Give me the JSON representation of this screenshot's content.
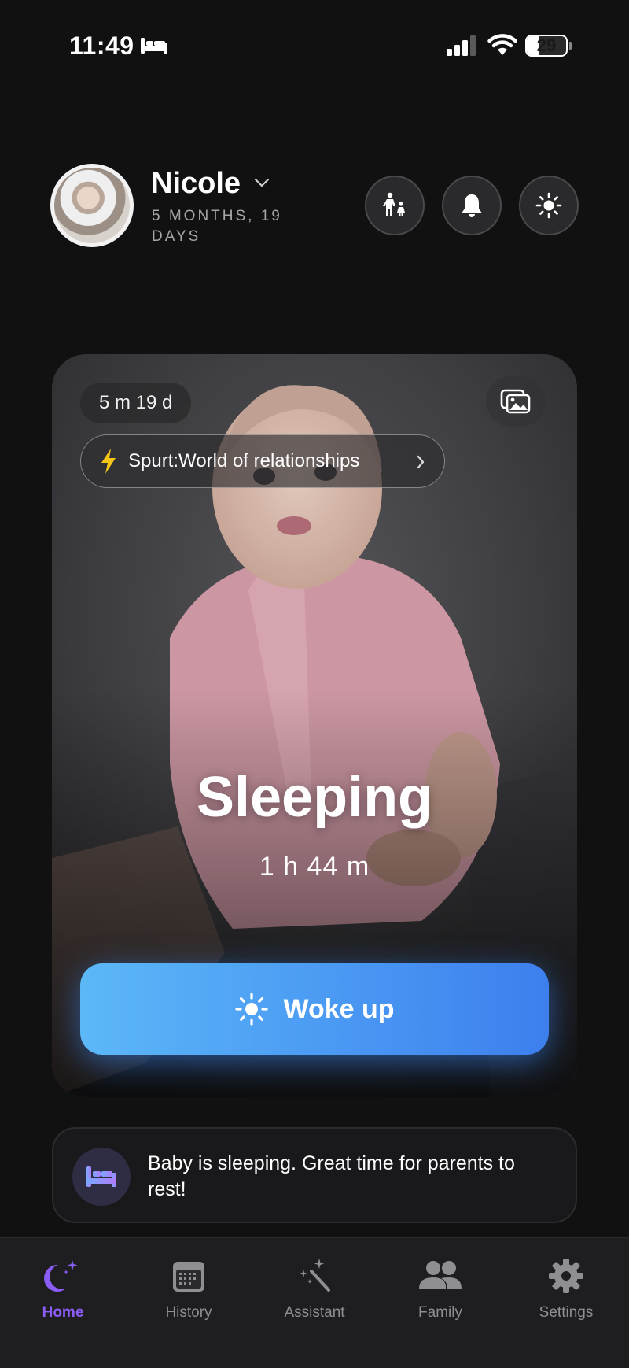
{
  "status_bar": {
    "time": "11:49",
    "battery_level": "29",
    "icons": [
      "sleep-mode-icon",
      "signal-icon",
      "wifi-icon",
      "battery-icon"
    ]
  },
  "header": {
    "child_name": "Nicole",
    "child_age": "5 MONTHS, 19 DAYS",
    "buttons": [
      "family-walk-icon",
      "bell-icon",
      "sun-icon"
    ]
  },
  "hero_card": {
    "age_chip": "5 m 19 d",
    "spurt_label": "Spurt:World of relationships",
    "status_title": "Sleeping",
    "status_duration": "1 h 44 m",
    "woke_button_label": "Woke up"
  },
  "tip": {
    "text": "Baby is sleeping. Great time for parents to rest!"
  },
  "nav": {
    "items": [
      {
        "label": "Home",
        "icon": "moon-stars-icon",
        "active": true
      },
      {
        "label": "History",
        "icon": "calendar-icon",
        "active": false
      },
      {
        "label": "Assistant",
        "icon": "magic-wand-icon",
        "active": false
      },
      {
        "label": "Family",
        "icon": "people-icon",
        "active": false
      },
      {
        "label": "Settings",
        "icon": "gear-icon",
        "active": false
      }
    ]
  },
  "colors": {
    "background": "#111112",
    "accent_purple": "#8b5cf6",
    "button_blue_start": "#5cb8f7",
    "button_blue_end": "#3d7fed",
    "spurt_bolt": "#f5c518"
  }
}
